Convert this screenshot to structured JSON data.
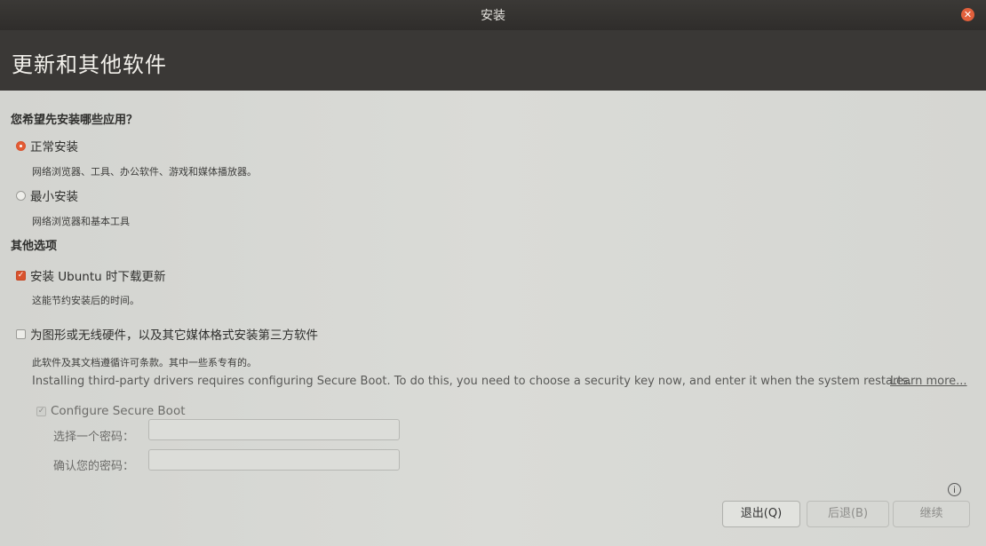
{
  "window": {
    "title": "安装"
  },
  "header": {
    "title": "更新和其他软件"
  },
  "install_question": "您希望先安装哪些应用？",
  "options": {
    "normal": {
      "label": "正常安装",
      "desc": "网络浏览器、工具、办公软件、游戏和媒体播放器。",
      "selected": true
    },
    "minimal": {
      "label": "最小安装",
      "desc": "网络浏览器和基本工具",
      "selected": false
    }
  },
  "other_options_title": "其他选项",
  "download_updates": {
    "label": "安装 Ubuntu 时下载更新",
    "desc": "这能节约安装后的时间。",
    "checked": true
  },
  "third_party": {
    "label": "为图形或无线硬件，以及其它媒体格式安装第三方软件",
    "desc": "此软件及其文档遵循许可条款。其中一些系专有的。",
    "checked": false
  },
  "secure_boot": {
    "info": "Installing third-party drivers requires configuring Secure Boot. To do this, you need to choose a security key now, and enter it when the system restarts.",
    "learn_more": "Learn more...",
    "configure_label": "Configure Secure Boot",
    "password_label": "选择一个密码：",
    "confirm_label": "确认您的密码：",
    "password_value": "",
    "confirm_value": ""
  },
  "buttons": {
    "quit": "退出(Q)",
    "back": "后退(B)",
    "continue": "继续"
  },
  "colors": {
    "accent": "#e35c35",
    "header_bg": "#3a3836",
    "body_bg": "#d9dad6"
  }
}
